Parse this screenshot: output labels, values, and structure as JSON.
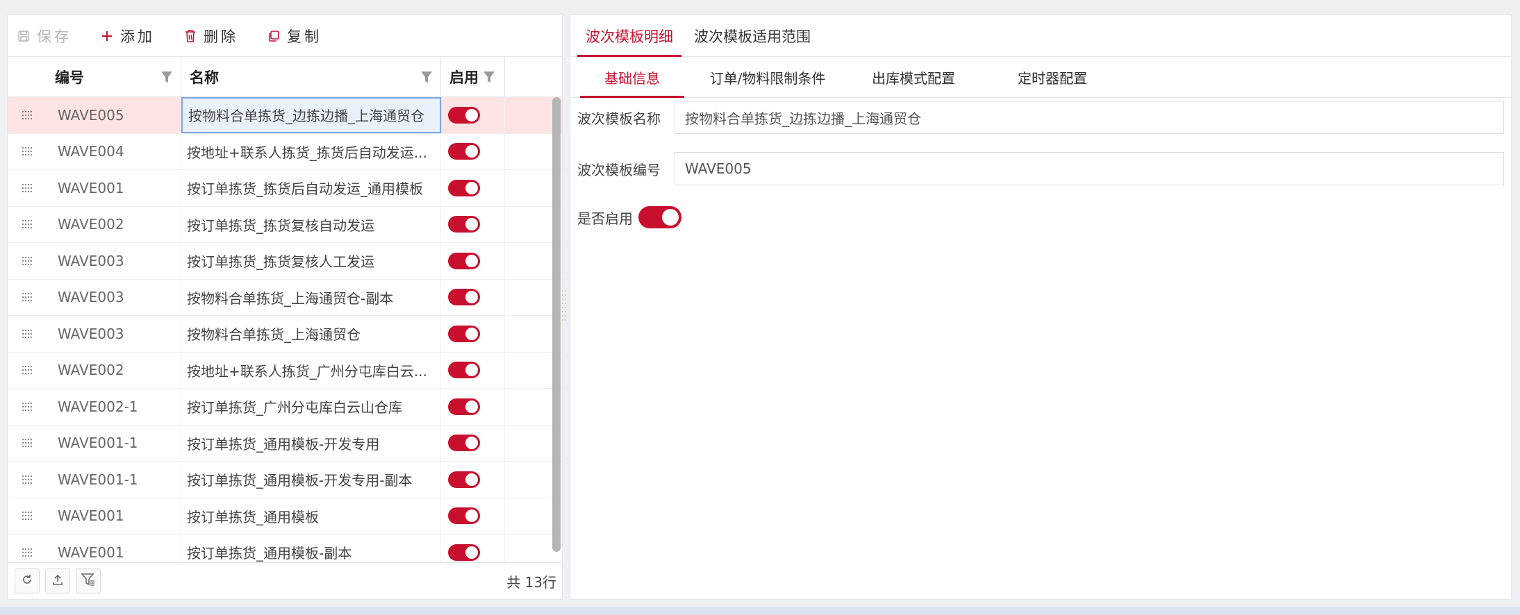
{
  "toolbar": {
    "save_label": "保存",
    "add_label": "添加",
    "delete_label": "删除",
    "copy_label": "复制"
  },
  "grid": {
    "headers": {
      "code": "编号",
      "name": "名称",
      "enabled": "启用"
    },
    "rows": [
      {
        "code": "WAVE005",
        "name": "按物料合单拣货_边拣边播_上海通贸仓",
        "enabled": true,
        "selected": true
      },
      {
        "code": "WAVE004",
        "name": "按地址+联系人拣货_拣货后自动发运...",
        "enabled": true
      },
      {
        "code": "WAVE001",
        "name": "按订单拣货_拣货后自动发运_通用模板",
        "enabled": true
      },
      {
        "code": "WAVE002",
        "name": "按订单拣货_拣货复核自动发运",
        "enabled": true
      },
      {
        "code": "WAVE003",
        "name": "按订单拣货_拣货复核人工发运",
        "enabled": true
      },
      {
        "code": "WAVE003",
        "name": "按物料合单拣货_上海通贸仓-副本",
        "enabled": true
      },
      {
        "code": "WAVE003",
        "name": "按物料合单拣货_上海通贸仓",
        "enabled": true
      },
      {
        "code": "WAVE002",
        "name": "按地址+联系人拣货_广州分屯库白云...",
        "enabled": true
      },
      {
        "code": "WAVE002-1",
        "name": "按订单拣货_广州分屯库白云山仓库",
        "enabled": true
      },
      {
        "code": "WAVE001-1",
        "name": "按订单拣货_通用模板-开发专用",
        "enabled": true
      },
      {
        "code": "WAVE001-1",
        "name": "按订单拣货_通用模板-开发专用-副本",
        "enabled": true
      },
      {
        "code": "WAVE001",
        "name": "按订单拣货_通用模板",
        "enabled": true
      },
      {
        "code": "WAVE001",
        "name": "按订单拣货_通用模板-副本",
        "enabled": true
      }
    ],
    "footer_count": "共 13行"
  },
  "right": {
    "tabs": [
      "波次模板明细",
      "波次模板适用范围"
    ],
    "subtabs": [
      "基础信息",
      "订单/物料限制条件",
      "出库模式配置",
      "定时器配置"
    ],
    "form": {
      "name_label": "波次模板名称",
      "name_value": "按物料合单拣货_边拣边播_上海通贸仓",
      "code_label": "波次模板编号",
      "code_value": "WAVE005",
      "enabled_label": "是否启用",
      "enabled": true
    }
  },
  "colors": {
    "accent": "#c8102e",
    "selected_row": "#fde3e3"
  }
}
